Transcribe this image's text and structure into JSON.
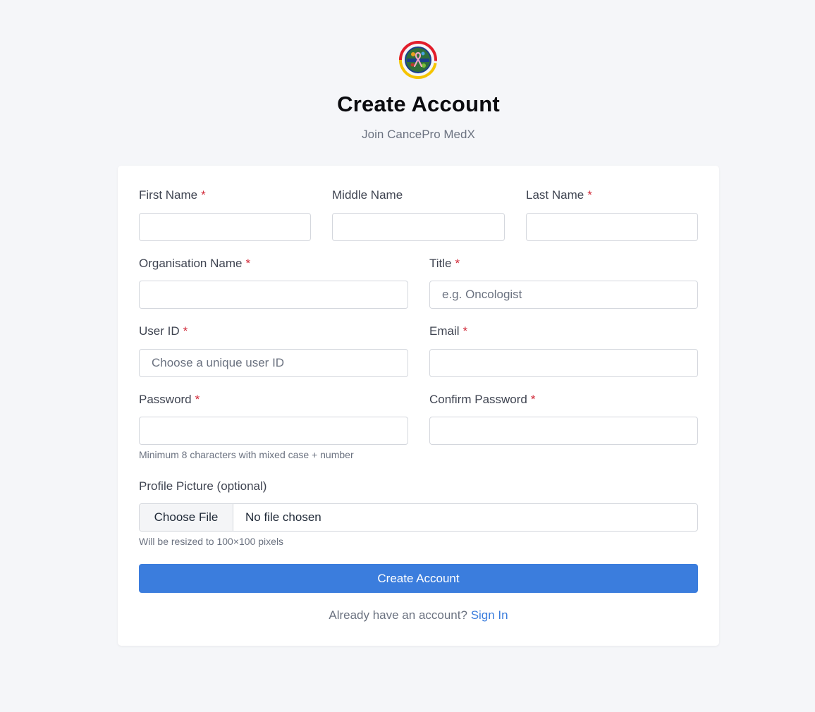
{
  "brand": {
    "logo_icon": "cancer-ribbon-logo-icon",
    "colors": {
      "primary": "#3b7ddd",
      "required_marker": "#d12b3a",
      "logo_ring_red": "#e21d2b",
      "logo_ring_yellow": "#f5c400"
    }
  },
  "header": {
    "title": "Create Account",
    "subtitle": "Join CancePro MedX"
  },
  "form": {
    "required_marker": "*",
    "first_name": {
      "label": "First Name",
      "value": "",
      "placeholder": ""
    },
    "middle_name": {
      "label": "Middle Name",
      "value": "",
      "placeholder": ""
    },
    "last_name": {
      "label": "Last Name",
      "value": "",
      "placeholder": ""
    },
    "organisation_name": {
      "label": "Organisation Name",
      "value": "",
      "placeholder": ""
    },
    "title": {
      "label": "Title",
      "value": "",
      "placeholder": "e.g. Oncologist"
    },
    "user_id": {
      "label": "User ID",
      "value": "",
      "placeholder": "Choose a unique user ID"
    },
    "email": {
      "label": "Email",
      "value": "",
      "placeholder": ""
    },
    "password": {
      "label": "Password",
      "value": "",
      "placeholder": "",
      "hint": "Minimum 8 characters with mixed case + number"
    },
    "confirm_password": {
      "label": "Confirm Password",
      "value": "",
      "placeholder": ""
    },
    "profile_picture": {
      "label": "Profile Picture (optional)",
      "button_label": "Choose File",
      "status": "No file chosen",
      "hint": "Will be resized to 100×100 pixels"
    },
    "submit_label": "Create Account",
    "signin_prompt": "Already have an account?",
    "signin_link": "Sign In"
  }
}
